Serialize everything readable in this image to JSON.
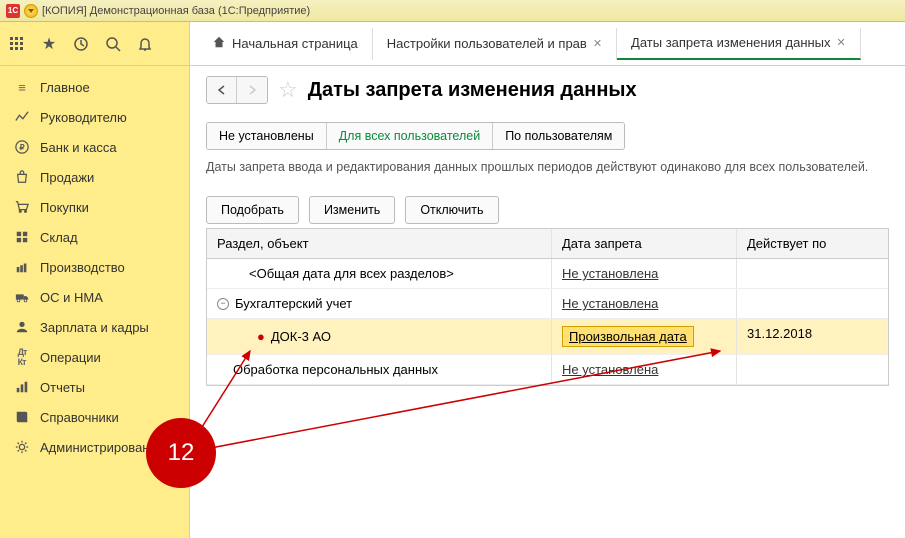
{
  "titlebar": {
    "text": "[КОПИЯ] Демонстрационная база  (1С:Предприятие)",
    "logo": "1C"
  },
  "toolbar_icons": [
    "apps",
    "star",
    "history",
    "search",
    "bell"
  ],
  "tabs": [
    {
      "icon": "home",
      "label": "Начальная страница",
      "closable": false
    },
    {
      "label": "Настройки пользователей и прав",
      "closable": true
    },
    {
      "label": "Даты запрета изменения данных",
      "closable": true,
      "active": true
    }
  ],
  "sidebar": {
    "items": [
      {
        "icon": "menu",
        "label": "Главное"
      },
      {
        "icon": "chart",
        "label": "Руководителю"
      },
      {
        "icon": "ruble",
        "label": "Банк и касса"
      },
      {
        "icon": "bag",
        "label": "Продажи"
      },
      {
        "icon": "cart",
        "label": "Покупки"
      },
      {
        "icon": "stack",
        "label": "Склад"
      },
      {
        "icon": "factory",
        "label": "Производство"
      },
      {
        "icon": "truck",
        "label": "ОС и НМА"
      },
      {
        "icon": "people",
        "label": "Зарплата и кадры"
      },
      {
        "icon": "ops",
        "label": "Операции"
      },
      {
        "icon": "bars",
        "label": "Отчеты"
      },
      {
        "icon": "book",
        "label": "Справочники"
      },
      {
        "icon": "gear",
        "label": "Администрирование"
      }
    ]
  },
  "page": {
    "title": "Даты запрета изменения данных",
    "filters": [
      {
        "label": "Не установлены"
      },
      {
        "label": "Для всех пользователей",
        "active": true
      },
      {
        "label": "По пользователям"
      }
    ],
    "note": "Даты запрета ввода и редактирования данных прошлых периодов действуют одинаково для всех пользователей.",
    "actions": {
      "pick": "Подобрать",
      "edit": "Изменить",
      "off": "Отключить"
    },
    "grid": {
      "headers": {
        "c1": "Раздел, объект",
        "c2": "Дата запрета",
        "c3": "Действует по"
      },
      "rows": [
        {
          "indent": 1,
          "label": "<Общая дата для всех разделов>",
          "date": "Не установлена",
          "until": ""
        },
        {
          "indent": 0,
          "expander": "−",
          "label": "Бухгалтерский учет",
          "date": "Не установлена",
          "until": ""
        },
        {
          "indent": 2,
          "highlight": true,
          "bullet": true,
          "label": "ДОК-3 АО",
          "date": "Произвольная дата",
          "datebox": true,
          "until": "31.12.2018"
        },
        {
          "indent": 1,
          "label": "Обработка персональных данных",
          "date": "Не установлена",
          "until": ""
        }
      ]
    }
  },
  "annotation": {
    "number": "12"
  }
}
